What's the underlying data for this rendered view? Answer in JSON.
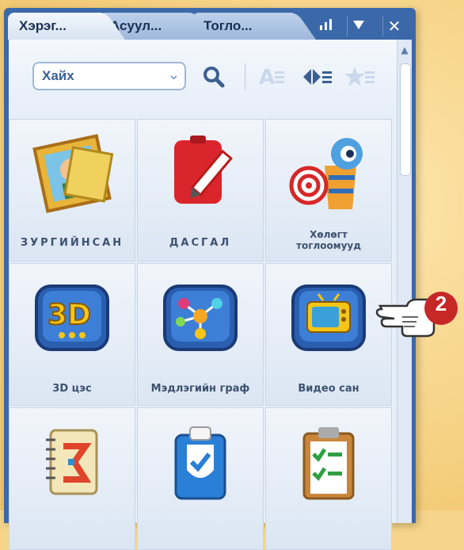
{
  "tabs": [
    {
      "label": "Хэрэг..."
    },
    {
      "label": "Асуул..."
    },
    {
      "label": "Тогло..."
    }
  ],
  "window_controls": {
    "signal_icon": "signal-bars-icon",
    "dropdown_icon": "triangle-down-icon",
    "close_label": "✕"
  },
  "toolbar": {
    "search_placeholder": "Хайх",
    "icons": [
      "search-icon",
      "text-size-icon",
      "flip-icon",
      "favorites-icon"
    ]
  },
  "grid": {
    "items": [
      {
        "label": "ЗУРГИЙНСАН",
        "icon": "picture-frame-icon"
      },
      {
        "label": "ДАСГАЛ",
        "icon": "red-notebook-pencil-icon"
      },
      {
        "label": "Хөлөгт",
        "label2": "тоглоомууд",
        "icon": "target-eye-icon"
      },
      {
        "label": "3D цэс",
        "icon": "3d-icon"
      },
      {
        "label": "Мэдлэгийн граф",
        "icon": "graph-nodes-icon"
      },
      {
        "label": "Видео сан",
        "icon": "tv-icon"
      },
      {
        "label": "",
        "icon": "sigma-notebook-icon"
      },
      {
        "label": "",
        "icon": "clipboard-check-icon"
      },
      {
        "label": "",
        "icon": "checklist-clipboard-icon"
      }
    ]
  },
  "callout": {
    "number": "2",
    "icon": "pointing-hand-icon"
  },
  "colors": {
    "accent": "#3b68a8",
    "badge": "#c62828"
  }
}
